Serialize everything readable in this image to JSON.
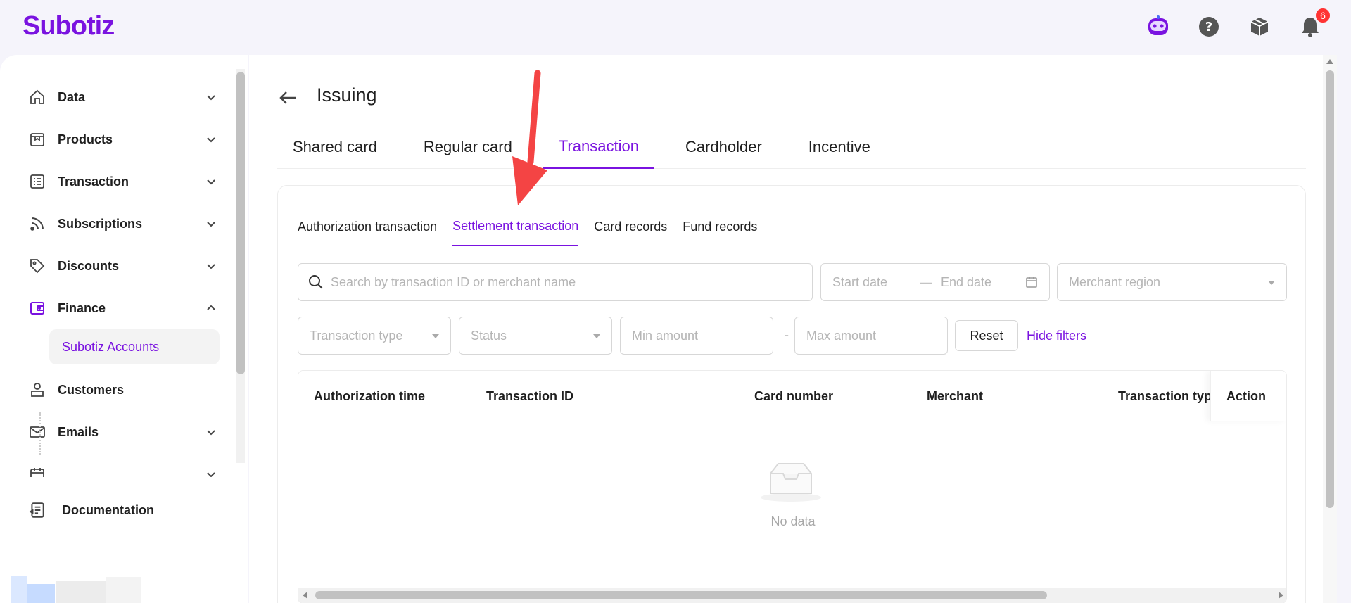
{
  "app": {
    "logo": "Subotiz",
    "notification_count": "6"
  },
  "colors": {
    "brand": "#7a13e0",
    "badge": "#ff3333",
    "annotation_arrow": "#f44444"
  },
  "top_icons": [
    "assistant-bot-icon",
    "help-icon",
    "package-icon",
    "bell-icon"
  ],
  "sidebar": {
    "items": [
      {
        "label": "Data",
        "icon": "home-icon",
        "expanded": false
      },
      {
        "label": "Products",
        "icon": "product-icon",
        "expanded": false
      },
      {
        "label": "Transaction",
        "icon": "list-icon",
        "expanded": false
      },
      {
        "label": "Subscriptions",
        "icon": "rss-icon",
        "expanded": false
      },
      {
        "label": "Discounts",
        "icon": "tag-icon",
        "expanded": false
      },
      {
        "label": "Finance",
        "icon": "wallet-icon",
        "expanded": true
      },
      {
        "label": "Customers",
        "icon": "user-icon",
        "expanded": false
      },
      {
        "label": "Emails",
        "icon": "mail-icon",
        "expanded": false
      }
    ],
    "finance_sub": {
      "label": "Subotiz Accounts"
    },
    "documentation": "Documentation"
  },
  "page": {
    "title": "Issuing",
    "tabs": [
      "Shared card",
      "Regular card",
      "Transaction",
      "Cardholder",
      "Incentive"
    ],
    "active_tab": "Transaction",
    "subtabs": [
      "Authorization transaction",
      "Settlement transaction",
      "Card records",
      "Fund records"
    ],
    "active_subtab": "Settlement transaction"
  },
  "filters": {
    "search_placeholder": "Search by transaction ID or merchant name",
    "start_date": "Start date",
    "date_separator": "—",
    "end_date": "End date",
    "merchant_region": "Merchant region",
    "transaction_type": "Transaction type",
    "status": "Status",
    "min_amount": "Min amount",
    "range_separator": "-",
    "max_amount": "Max amount",
    "reset": "Reset",
    "hide_filters": "Hide filters"
  },
  "table": {
    "columns": [
      "Authorization time",
      "Transaction ID",
      "Card number",
      "Merchant",
      "Transaction typ",
      "Action"
    ],
    "empty_text": "No data"
  }
}
